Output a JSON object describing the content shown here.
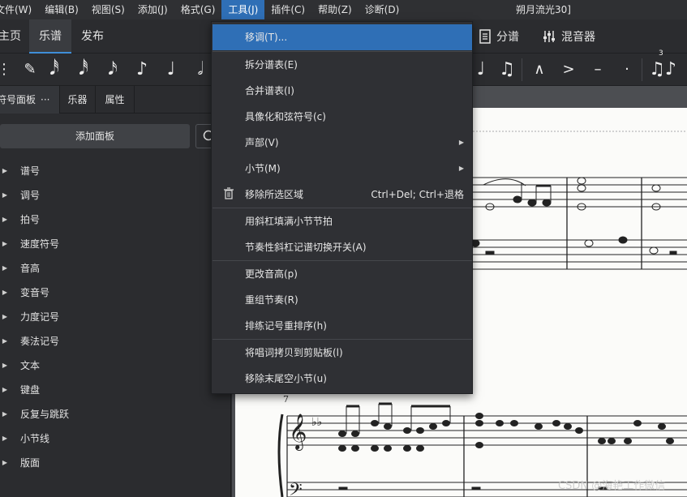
{
  "menubar": {
    "items": [
      {
        "label": "文件(W)"
      },
      {
        "label": "编辑(B)"
      },
      {
        "label": "视图(S)"
      },
      {
        "label": "添加(J)"
      },
      {
        "label": "格式(G)"
      },
      {
        "label": "工具(J)"
      },
      {
        "label": "插件(C)"
      },
      {
        "label": "帮助(Z)"
      },
      {
        "label": "诊断(D)"
      }
    ],
    "window_title": "朔月流光30]"
  },
  "tabs": {
    "home": "主页",
    "score": "乐谱",
    "publish": "发布",
    "parts": "分谱",
    "mixer": "混音器"
  },
  "palette_panel": {
    "tabs": [
      "符号面板",
      "乐器",
      "属性"
    ],
    "more": "···",
    "add_button": "添加面板",
    "items": [
      "谱号",
      "调号",
      "拍号",
      "速度符号",
      "音高",
      "变音号",
      "力度记号",
      "奏法记号",
      "文本",
      "键盘",
      "反复与跳跃",
      "小节线",
      "版面"
    ]
  },
  "tools_menu": {
    "items": [
      {
        "label": "移调(T)...",
        "shortcut": ""
      },
      {
        "label": "拆分谱表(E)",
        "shortcut": ""
      },
      {
        "label": "合并谱表(I)",
        "shortcut": ""
      },
      {
        "label": "具像化和弦符号(c)",
        "shortcut": ""
      },
      {
        "label": "声部(V)",
        "shortcut": ""
      },
      {
        "label": "小节(M)",
        "shortcut": ""
      },
      {
        "label": "移除所选区域",
        "shortcut": "Ctrl+Del; Ctrl+退格"
      },
      {
        "label": "用斜杠填满小节节拍",
        "shortcut": ""
      },
      {
        "label": "节奏性斜杠记谱切换开关(A)",
        "shortcut": ""
      },
      {
        "label": "更改音高(p)",
        "shortcut": ""
      },
      {
        "label": "重组节奏(R)",
        "shortcut": ""
      },
      {
        "label": "排练记号重排序(h)",
        "shortcut": ""
      },
      {
        "label": "将唱词拷贝到剪贴板(l)",
        "shortcut": ""
      },
      {
        "label": "移除末尾空小节(u)",
        "shortcut": ""
      }
    ]
  },
  "score": {
    "measure_number": "7",
    "tuplet_number": "3"
  },
  "watermark": "CSDN @海艳工作微信",
  "colors": {
    "accent": "#2f6fb6",
    "menu_bg": "#2f3034",
    "panel_bg": "#2b2c2f",
    "paper": "#fbfbf9"
  }
}
